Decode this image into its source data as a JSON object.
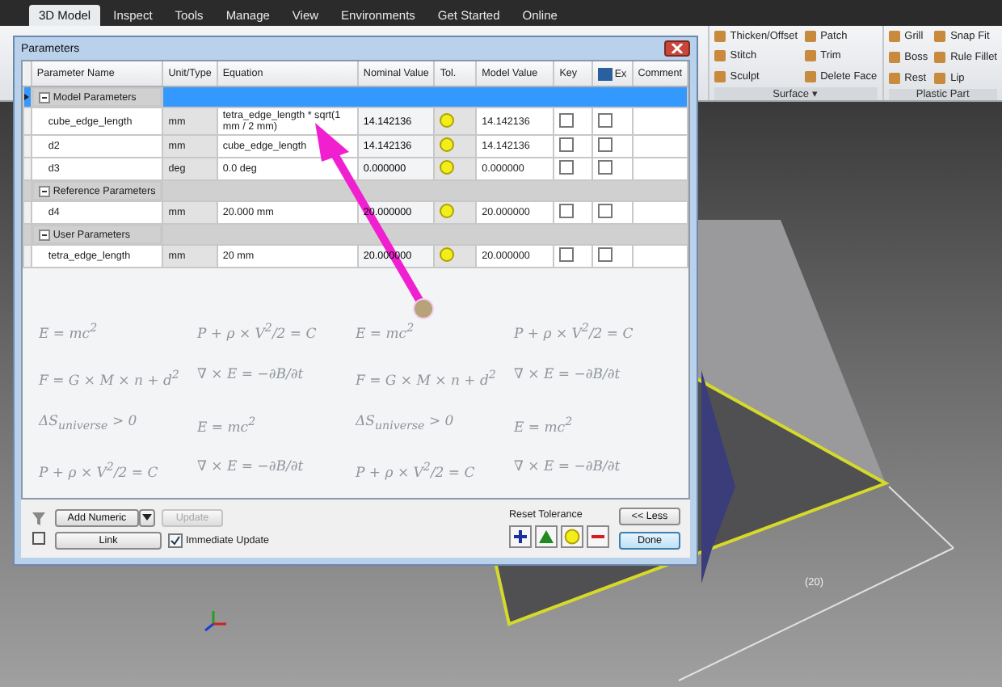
{
  "ribbon_tabs": [
    {
      "label": "3D Model",
      "selected": true
    },
    {
      "label": "Inspect",
      "selected": false
    },
    {
      "label": "Tools",
      "selected": false
    },
    {
      "label": "Manage",
      "selected": false
    },
    {
      "label": "View",
      "selected": false
    },
    {
      "label": "Environments",
      "selected": false
    },
    {
      "label": "Get Started",
      "selected": false
    },
    {
      "label": "Online",
      "selected": false
    }
  ],
  "ribbon_panels": [
    {
      "label": "Surface ▾",
      "columns": [
        [
          "Thicken/Offset",
          "Stitch",
          "Sculpt"
        ],
        [
          "Patch",
          "Trim",
          "Delete Face"
        ]
      ]
    },
    {
      "label": "Plastic Part",
      "columns": [
        [
          "Grill",
          "Boss",
          "Rest"
        ],
        [
          "Snap Fit",
          "Rule Fillet",
          "Lip"
        ]
      ]
    }
  ],
  "dialog": {
    "title": "Parameters",
    "columns": [
      "Parameter Name",
      "Unit/Type",
      "Equation",
      "Nominal Value",
      "Tol.",
      "Model Value",
      "Key",
      "Ex",
      "Comment"
    ],
    "groups": [
      {
        "name": "Model Parameters",
        "expanded": true,
        "selected": true,
        "children": [
          {
            "name": "cube_edge_length",
            "unit": "mm",
            "equation": "tetra_edge_length * sqrt(1 mm / 2 mm)",
            "nominal": "14.142136",
            "model": "14.142136",
            "key": false,
            "export": false
          },
          {
            "name": "d2",
            "unit": "mm",
            "equation": "cube_edge_length",
            "nominal": "14.142136",
            "model": "14.142136",
            "key": false,
            "export": false
          },
          {
            "name": "d3",
            "unit": "deg",
            "equation": "0.0 deg",
            "nominal": "0.000000",
            "model": "0.000000",
            "key": false,
            "export": false
          }
        ]
      },
      {
        "name": "Reference Parameters",
        "expanded": true,
        "selected": false,
        "children": [
          {
            "name": "d4",
            "unit": "mm",
            "equation": "20.000 mm",
            "nominal": "20.000000",
            "model": "20.000000",
            "key": false,
            "export": false
          }
        ]
      },
      {
        "name": "User Parameters",
        "expanded": true,
        "selected": false,
        "children": [
          {
            "name": "tetra_edge_length",
            "unit": "mm",
            "equation": "20 mm",
            "nominal": "20.000000",
            "model": "20.000000",
            "key": false,
            "export": false
          }
        ]
      }
    ],
    "formulas": [
      "E = mc$^{2}$",
      "P + ρ × V$^{2}$/2 = C",
      "E = mc$^{2}$",
      "P + ρ × V$^{2}$/2 = C",
      "F = G × M × n + d$^{2}$",
      "∇ × E = −∂B/∂t",
      "F = G × M × n + d$^{2}$",
      "∇ × E = −∂B/∂t",
      "ΔS$_{universe}$ > 0",
      "E = mc$^{2}$",
      "ΔS$_{universe}$ > 0",
      "E = mc$^{2}$",
      "P + ρ × V$^{2}$/2 = C",
      "∇ × E = −∂B/∂t",
      "P + ρ × V$^{2}$/2 = C",
      "∇ × E = −∂B/∂t"
    ],
    "add_button": "Add Numeric",
    "update_button": {
      "label": "Update",
      "disabled": true
    },
    "link_button": "Link",
    "immediate_update": {
      "label": "Immediate Update",
      "checked": true
    },
    "reset_tolerance": "Reset Tolerance",
    "less_button": "<< Less",
    "done_button": "Done"
  },
  "dimension": "(20)"
}
